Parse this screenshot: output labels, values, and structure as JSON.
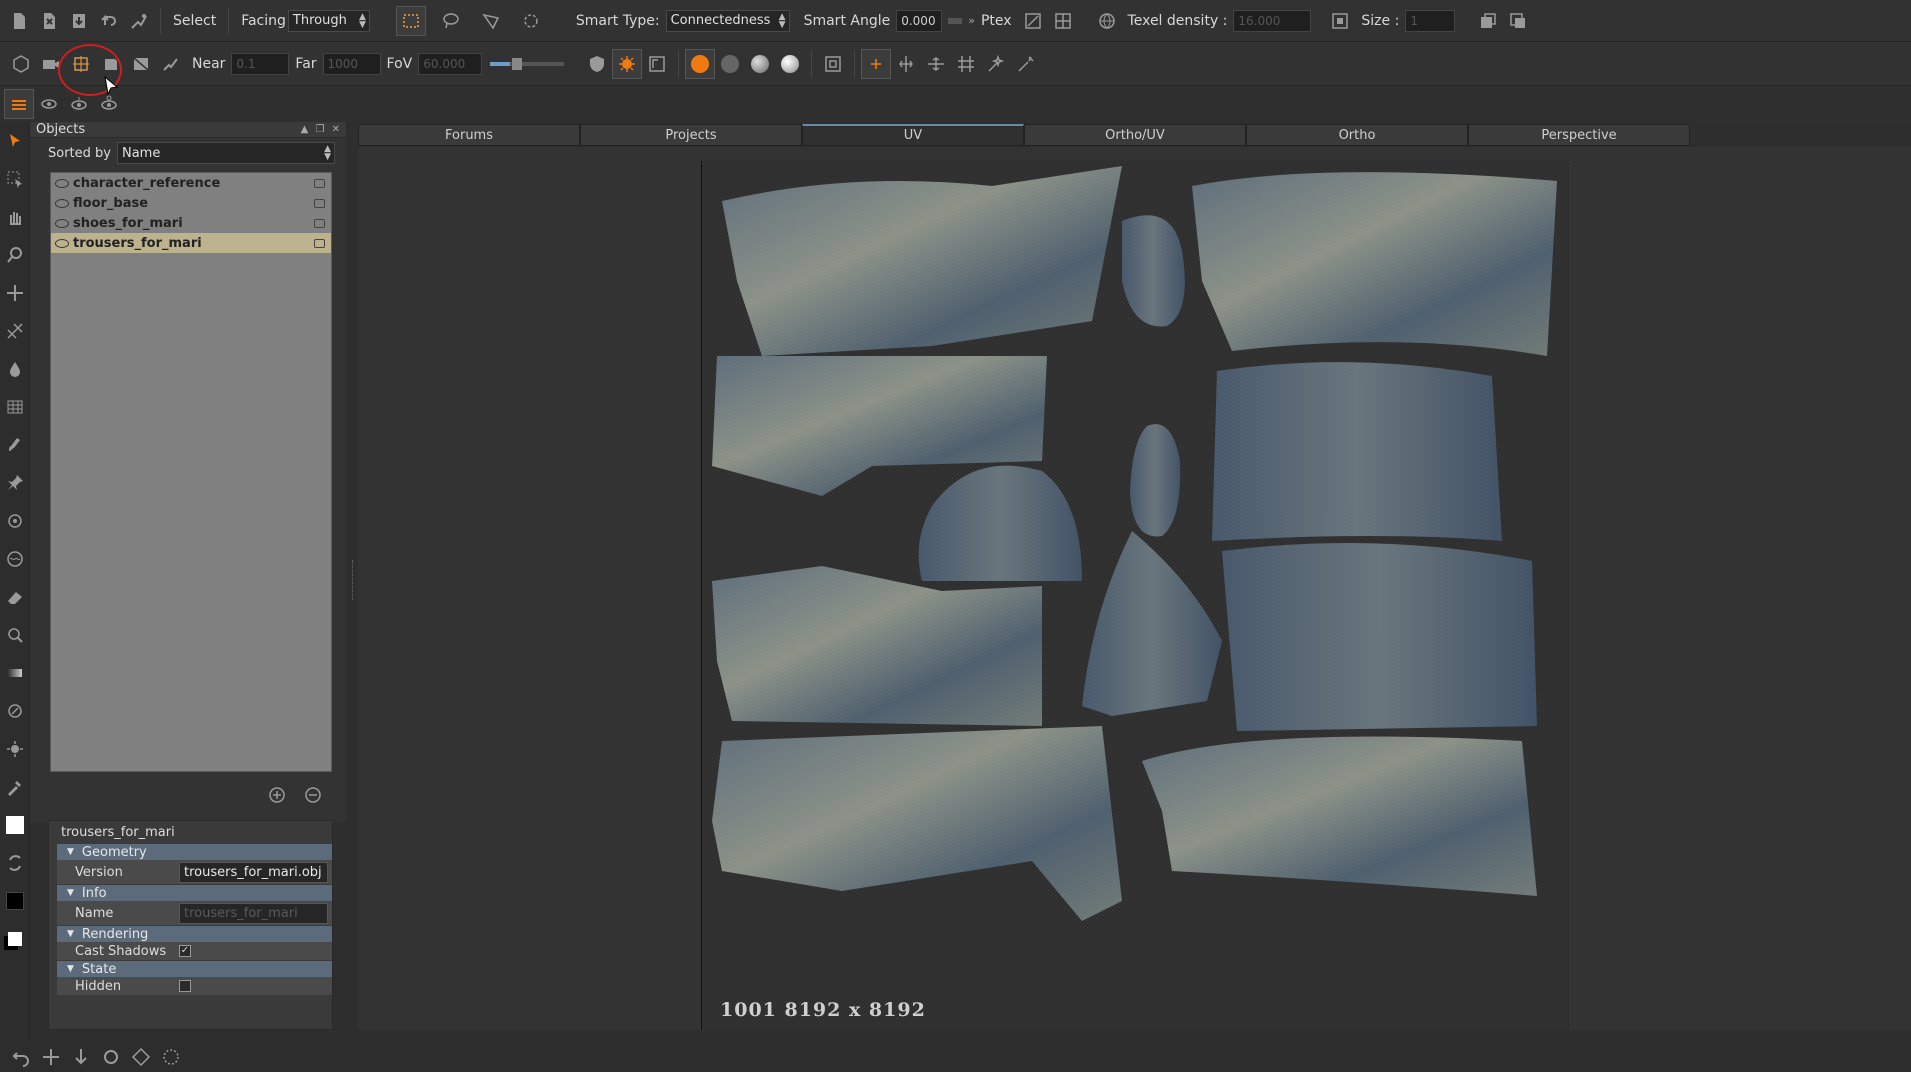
{
  "toolbar_top": {
    "select_label": "Select",
    "facing_label": "Facing",
    "facing_value": "Through",
    "smart_type_label": "Smart Type:",
    "smart_type_value": "Connectedness",
    "smart_angle_label": "Smart Angle",
    "smart_angle_value": "0.000",
    "ptex_label": "Ptex",
    "texel_density_label": "Texel density :",
    "texel_density_value": "16.000",
    "size_label": "Size :",
    "size_value": "1"
  },
  "toolbar_camera": {
    "near_label": "Near",
    "near_value": "0.1",
    "far_label": "Far",
    "far_value": "1000",
    "fov_label": "FoV",
    "fov_value": "60.000"
  },
  "objects_panel": {
    "title": "Objects",
    "sorted_by_label": "Sorted by",
    "sorted_by_value": "Name",
    "items": [
      {
        "name": "character_reference",
        "selected": false
      },
      {
        "name": "floor_base",
        "selected": false
      },
      {
        "name": "shoes_for_mari",
        "selected": false
      },
      {
        "name": "trousers_for_mari",
        "selected": true
      }
    ]
  },
  "properties": {
    "object_name": "trousers_for_mari",
    "geometry_section": "Geometry",
    "version_label": "Version",
    "version_value": "trousers_for_mari.obj",
    "info_section": "Info",
    "name_label": "Name",
    "name_value": "trousers_for_mari",
    "rendering_section": "Rendering",
    "cast_shadows_label": "Cast Shadows",
    "cast_shadows_checked": true,
    "state_section": "State",
    "hidden_label": "Hidden",
    "hidden_checked": false
  },
  "tabs": [
    "Forums",
    "Projects",
    "UV",
    "Ortho/UV",
    "Ortho",
    "Perspective"
  ],
  "active_tab": "UV",
  "viewport": {
    "uv_tile_label": "1001 8192 x 8192"
  },
  "colors": {
    "accent_orange": "#f07a10",
    "selected_row": "#bcb38e",
    "section_header": "#5c6b7c",
    "annotation_red": "#cc1f1f"
  }
}
